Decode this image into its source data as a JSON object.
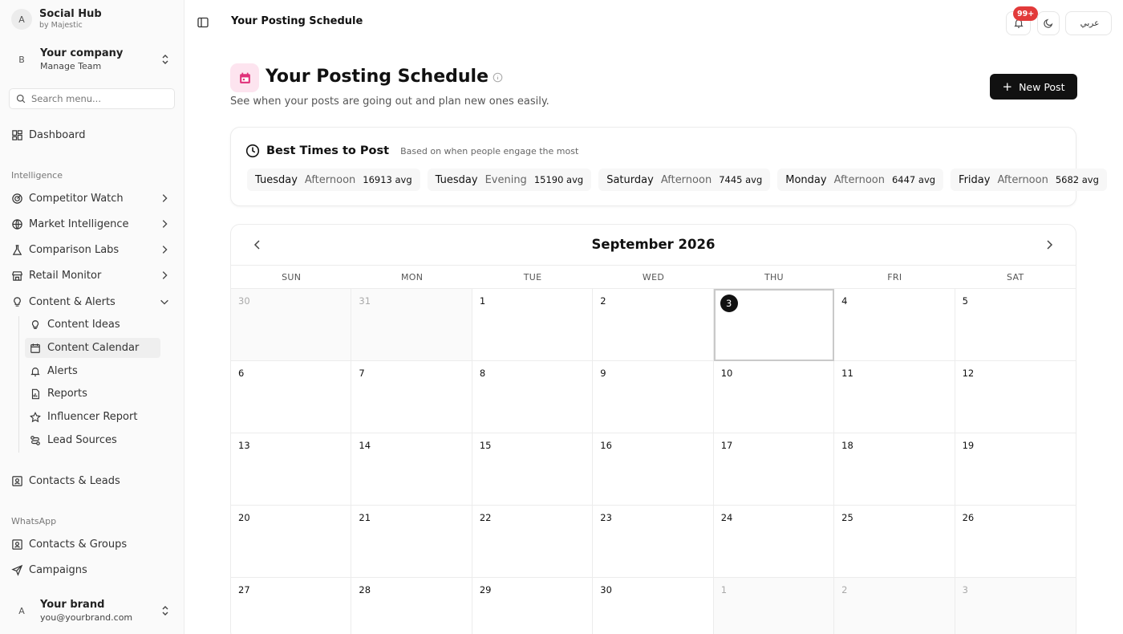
{
  "brand": {
    "avatar": "A",
    "title": "Social Hub",
    "subtitle": "by Majestic"
  },
  "company": {
    "avatar": "B",
    "title": "Your company",
    "subtitle": "Manage Team"
  },
  "search": {
    "placeholder": "Search menu..."
  },
  "nav": {
    "dashboard": "Dashboard",
    "intelligence_label": "Intelligence",
    "competitor_watch": "Competitor Watch",
    "market_intelligence": "Market Intelligence",
    "comparison_labs": "Comparison Labs",
    "retail_monitor": "Retail Monitor",
    "content_alerts": "Content & Alerts",
    "sub": {
      "content_ideas": "Content Ideas",
      "content_calendar": "Content Calendar",
      "alerts": "Alerts",
      "reports": "Reports",
      "influencer_report": "Influencer Report",
      "lead_sources": "Lead Sources"
    },
    "contacts_leads": "Contacts & Leads",
    "whatsapp_label": "WhatsApp",
    "contacts_groups": "Contacts & Groups",
    "campaigns": "Campaigns"
  },
  "user": {
    "avatar": "A",
    "title": "Your brand",
    "email": "you@yourbrand.com"
  },
  "topbar": {
    "title": "Your Posting Schedule",
    "notifications_badge": "99+",
    "language_label": "عربي"
  },
  "header": {
    "title": "Your Posting Schedule",
    "subtitle": "See when your posts are going out and plan new ones easily.",
    "new_post_label": "New Post"
  },
  "best_times": {
    "title": "Best Times to Post",
    "description": "Based on when people engage the most",
    "slots": [
      {
        "day": "Tuesday",
        "part": "Afternoon",
        "avg": "16913 avg"
      },
      {
        "day": "Tuesday",
        "part": "Evening",
        "avg": "15190 avg"
      },
      {
        "day": "Saturday",
        "part": "Afternoon",
        "avg": "7445 avg"
      },
      {
        "day": "Monday",
        "part": "Afternoon",
        "avg": "6447 avg"
      },
      {
        "day": "Friday",
        "part": "Afternoon",
        "avg": "5682 avg"
      }
    ]
  },
  "calendar": {
    "month": "September 2026",
    "weekdays": [
      "SUN",
      "MON",
      "TUE",
      "WED",
      "THU",
      "FRI",
      "SAT"
    ],
    "days": [
      "30",
      "31",
      "1",
      "2",
      "3",
      "4",
      "5",
      "6",
      "7",
      "8",
      "9",
      "10",
      "11",
      "12",
      "13",
      "14",
      "15",
      "16",
      "17",
      "18",
      "19",
      "20",
      "21",
      "22",
      "23",
      "24",
      "25",
      "26",
      "27",
      "28",
      "29",
      "30",
      "1",
      "2",
      "3"
    ],
    "other_month_indexes": [
      0,
      1,
      32,
      33,
      34
    ],
    "today_index": 4
  },
  "colors": {
    "accent_pink": "#e0317a",
    "badge_red": "#e23a3a",
    "primary_button": "#111111"
  }
}
